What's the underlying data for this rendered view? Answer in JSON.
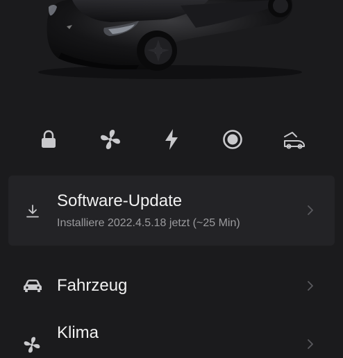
{
  "hero": {
    "image": "black-tesla-model-3"
  },
  "quick_controls": [
    {
      "icon": "lock-icon"
    },
    {
      "icon": "fan-icon"
    },
    {
      "icon": "charging-bolt-icon"
    },
    {
      "icon": "sentry-mode-icon"
    },
    {
      "icon": "frunk-trunk-icon"
    }
  ],
  "software_update": {
    "title": "Software-Update",
    "subtitle": "Installiere 2022.4.5.18 jetzt (~25 Min)",
    "icon": "download-icon"
  },
  "menu": {
    "vehicle": {
      "label": "Fahrzeug",
      "icon": "car-icon"
    },
    "climate": {
      "label": "Klima",
      "icon": "fan-icon"
    }
  },
  "colors": {
    "background": "#1b1b1d",
    "card": "#232326",
    "text": "#f1f1f1",
    "subtext": "#9b9b9e",
    "icon": "#c9c9cc"
  }
}
